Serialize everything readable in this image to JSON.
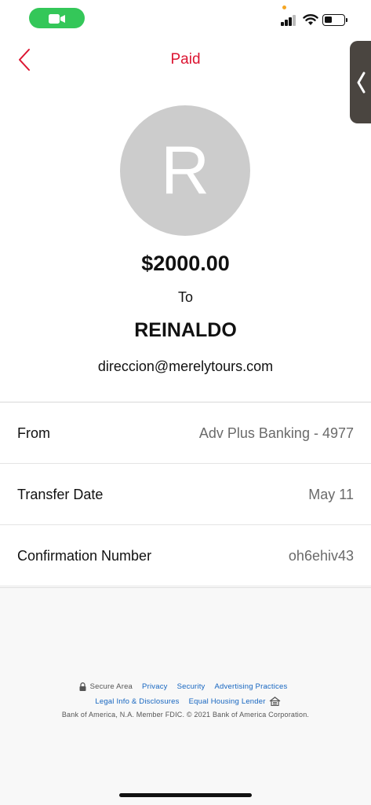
{
  "nav": {
    "title": "Paid"
  },
  "payment": {
    "amount": "$2000.00",
    "to_label": "To",
    "recipient_initial": "R",
    "recipient_name": "REINALDO",
    "recipient_email": "direccion@merelytours.com"
  },
  "details": [
    {
      "label": "From",
      "value": "Adv Plus Banking - 4977"
    },
    {
      "label": "Transfer Date",
      "value": "May 11"
    },
    {
      "label": "Confirmation Number",
      "value": "oh6ehiv43"
    }
  ],
  "footer": {
    "secure_area": "Secure Area",
    "privacy": "Privacy",
    "security": "Security",
    "advertising": "Advertising Practices",
    "legal": "Legal Info & Disclosures",
    "equal_housing": "Equal Housing Lender",
    "copyright": "Bank of America, N.A. Member FDIC. © 2021 Bank of America Corporation."
  },
  "icons": {
    "facetime": "video-camera-icon",
    "signal": "signal-icon",
    "wifi": "wifi-icon",
    "battery": "battery-icon",
    "back": "chevron-left-icon",
    "side_tab": "chevron-left-icon",
    "lock": "lock-icon",
    "house": "equal-housing-icon"
  },
  "colors": {
    "accent": "#dc1431",
    "link": "#1565c0",
    "facetime": "#34c759",
    "avatar_bg": "#cccccc"
  }
}
